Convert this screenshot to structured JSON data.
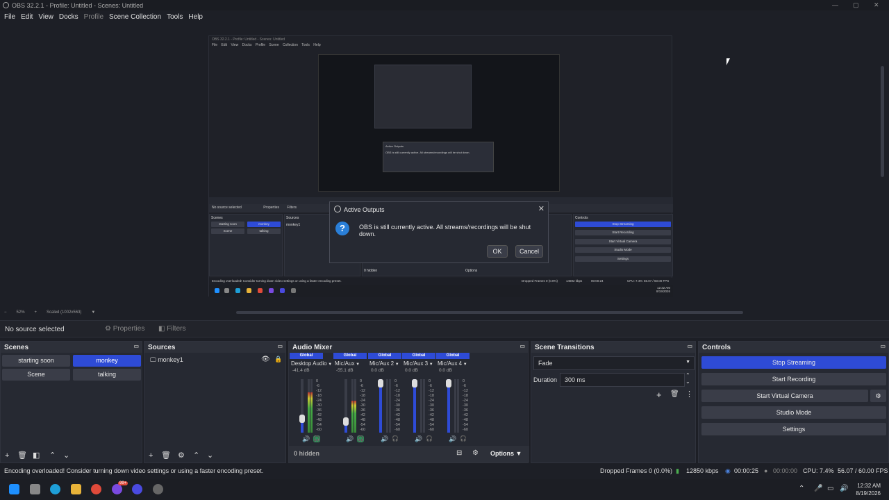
{
  "window": {
    "title": "OBS 32.2.1 - Profile: Untitled - Scenes: Untitled",
    "minimize": "—",
    "maximize": "▢",
    "close": "✕"
  },
  "menu": [
    "File",
    "Edit",
    "View",
    "Docks",
    "Profile",
    "Scene Collection",
    "Tools",
    "Help"
  ],
  "nested": {
    "title": "OBS 32.2.1 - Profile: Untitled - Scenes: Untitled",
    "menu": "File Edit View Docks Profile Scene Collection Tools Help",
    "dialog_title": "Active Outputs",
    "dialog_msg": "OBS is still currently active. All streams/recordings will be shut down.",
    "dialog_ok": "OK",
    "dialog_cancel": "Cancel",
    "no_source": "No source selected",
    "properties": "Properties",
    "filters": "Filters",
    "scenes_header": "Scenes",
    "sources_header": "Sources",
    "controls_header": "Controls",
    "source1": "monkey1",
    "hidden": "0 hidden",
    "options": "Options",
    "status_msg": "Encoding overloaded! Consider turning down video settings or using a faster encoding preset.",
    "dropped": "Dropped Frames 0 (0.0%)",
    "kbps": "14692 kbps",
    "time1": "00:00:24",
    "cpu": "CPU: 7.4%",
    "fps": "56.07 / 60.00 FPS",
    "clock_time": "12:32 AM",
    "clock_date": "8/19/2026",
    "scenes": [
      "starting soon",
      "monkey",
      "Scene",
      "talking"
    ],
    "controls": [
      "Stop Streaming",
      "Start Recording",
      "Start Virtual Camera",
      "Studio Mode",
      "Settings"
    ]
  },
  "dialog": {
    "title": "Active Outputs",
    "message": "OBS is still currently active. All streams/recordings will be shut down.",
    "ok": "OK",
    "cancel": "Cancel",
    "icon": "question-icon"
  },
  "zoom": {
    "minus": "−",
    "level": "52%",
    "plus": "+",
    "mode": "Scaled (1002x563)"
  },
  "source_toolbar": {
    "no_source": "No source selected",
    "properties": "Properties",
    "filters": "Filters"
  },
  "scenes": {
    "header": "Scenes",
    "items": [
      {
        "label": "starting soon"
      },
      {
        "label": "monkey",
        "selected": true
      },
      {
        "label": "Scene"
      },
      {
        "label": "talking"
      }
    ]
  },
  "sources": {
    "header": "Sources",
    "items": [
      {
        "label": "monkey1",
        "visible": true,
        "locked": false
      }
    ]
  },
  "mixer": {
    "header": "Audio Mixer",
    "hidden_label": "0 hidden",
    "options_label": "Options",
    "scale": [
      "0",
      "-6",
      "-12",
      "-18",
      "-24",
      "-30",
      "-36",
      "-42",
      "-48",
      "-54",
      "-60"
    ],
    "channels": [
      {
        "global": "Global",
        "name": "Desktop Audio",
        "db": "-41.4 dB",
        "level": 0.22,
        "fill": 0.75
      },
      {
        "global": "Global",
        "name": "Mic/Aux",
        "db": "-55.1 dB",
        "level": 0.15,
        "fill": 0.6
      },
      {
        "global": "Global",
        "name": "Mic/Aux 2",
        "db": "0.0 dB",
        "level": 1.0,
        "fill": 0
      },
      {
        "global": "Global",
        "name": "Mic/Aux 3",
        "db": "0.0 dB",
        "level": 1.0,
        "fill": 0
      },
      {
        "global": "Global",
        "name": "Mic/Aux 4",
        "db": "0.0 dB",
        "level": 1.0,
        "fill": 0
      }
    ]
  },
  "transitions": {
    "header": "Scene Transitions",
    "selected": "Fade",
    "duration_label": "Duration",
    "duration_value": "300 ms"
  },
  "controls": {
    "header": "Controls",
    "stop_streaming": "Stop Streaming",
    "start_recording": "Start Recording",
    "start_virtual_camera": "Start Virtual Camera",
    "studio_mode": "Studio Mode",
    "settings": "Settings"
  },
  "status": {
    "message": "Encoding overloaded! Consider turning down video settings or using a faster encoding preset.",
    "dropped_frames": "Dropped Frames 0 (0.0%)",
    "bitrate": "12850 kbps",
    "stream_time": "00:00:25",
    "record_time": "00:00:00",
    "cpu": "CPU: 7.4%",
    "fps": "56.07 / 60.00 FPS"
  },
  "taskbar": {
    "time": "12:32 AM",
    "date": "8/19/2026",
    "badge": "99+"
  },
  "colors": {
    "accent": "#2e4bd6",
    "bg": "#1d1f26",
    "panel": "#262932",
    "button": "#3a3d48"
  }
}
